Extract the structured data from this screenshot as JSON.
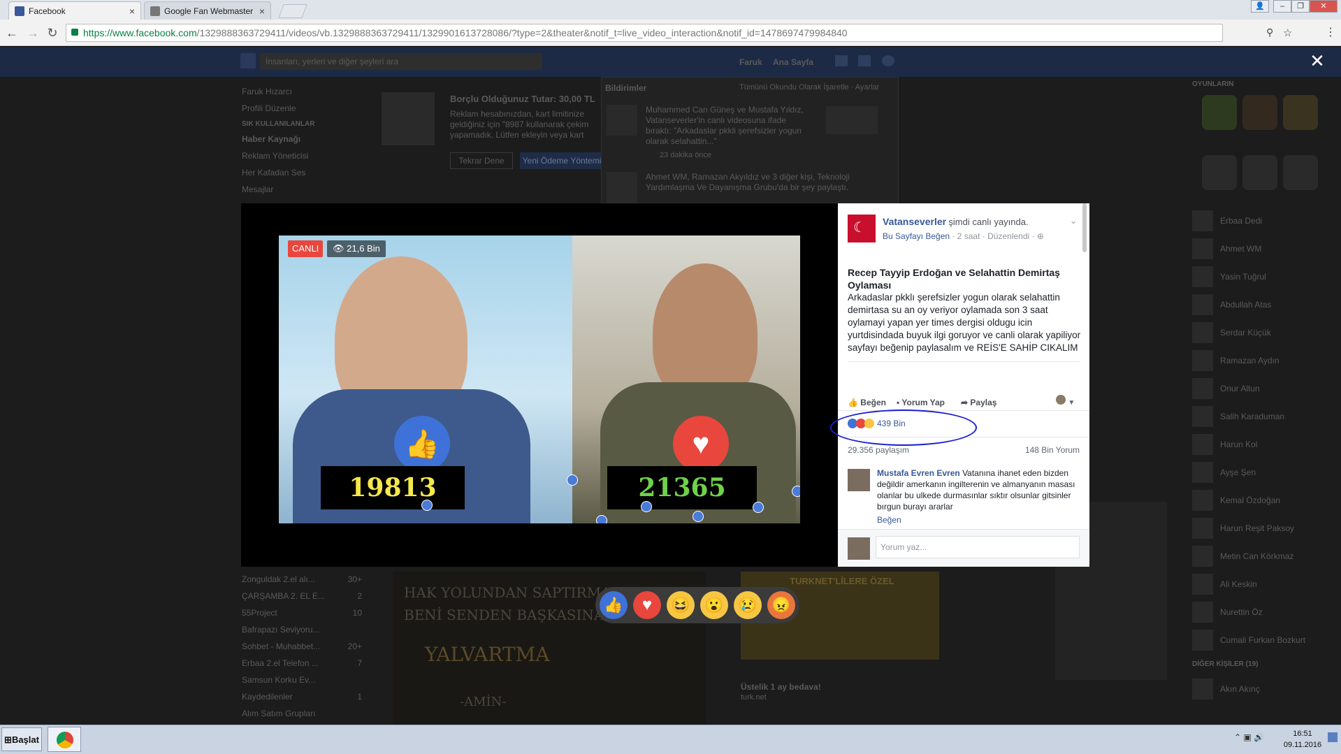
{
  "browser": {
    "tabs": [
      {
        "label": "Facebook",
        "active": true
      },
      {
        "label": "Google Fan Webmaster For",
        "active": false
      }
    ],
    "url_host": "https://www.facebook.com",
    "url_path": "/1329888363729411/videos/vb.1329888363729411/1329901613728086/?type=2&theater&notif_t=live_video_interaction&notif_id=1478697479984840"
  },
  "fb": {
    "search_placeholder": "İnsanları, yerleri ve diğer şeyleri ara",
    "user_name": "Faruk",
    "home_label": "Ana Sayfa",
    "left_nav": [
      "Faruk Hızarcı",
      "Profili Düzenle",
      "SIK KULLANILANLAR",
      "Haber Kaynağı",
      "Reklam Yöneticisi",
      "Her Kafadan Ses",
      "Mesajlar"
    ],
    "left_groups": [
      "Zonguldak 2.el alı...",
      "ÇARŞAMBA 2. EL E...",
      "55Project",
      "Bafrapazı Seviyoru...",
      "Sohbet - Muhabbet...",
      "Erbaa 2.el Telefon ...",
      "Samsun Korku Ev...",
      "Kaydedilenler",
      "Alım Satım Grupları"
    ],
    "left_group_counts": [
      "30+",
      "2",
      "10",
      "",
      "20+",
      "7",
      "",
      "1",
      ""
    ],
    "ad_title": "Borçlu Olduğunuz Tutar: 30,00 TL",
    "ad_text": "Reklam hesabınızdan, kart limitinize geldiğiniz için \"8987 kullanarak çekim yapamadık. Lütfen ekleyin veya kart bakiyenizi ödeyin ve geçin.",
    "ad_btn_retry": "Tekrar Dene",
    "ad_btn_new": "Yeni Ödeme Yöntemi",
    "notifications_title": "Bildirimler",
    "notifications_mark": "Tümünü Okundu Olarak İşaretle · Ayarlar",
    "notif1": "Muhammed Can Güneş ve Mustafa Yıldız, Vatanseverler'in canlı videosuna ifade bıraktı: \"Arkadaslar pkkli şerefsizler yogun olarak selahattin...\"",
    "notif1_time": "23 dakika önce",
    "notif2": "Ahmet WM, Ramazan Akyıldız ve 3 diğer kişi, Teknoloji Yardımlaşma Ve Dayanışma Grubu'da bir şey paylaştı.",
    "games_title": "OYUNLARIN",
    "chat_contacts": [
      "Erbaa Dedi",
      "Ahmet WM",
      "Yasin Tuğrul",
      "Abdullah Atas",
      "Serdar Küçük",
      "Ramazan Aydın",
      "Onur Altun",
      "Salih Karaduman",
      "Harun Kol",
      "Ayşe Şen",
      "Kemal Özdoğan",
      "Harun Reşit Paksoy",
      "Metin Can Körkmaz",
      "Ali Keskin",
      "Nurettin Öz",
      "Cumali Furkan Bozkurt"
    ],
    "other_people": "DİĞER KİŞİLER (19)",
    "other_person": "Akın Akınç",
    "banner_text": "TURKNET'LİLERE ÖZEL",
    "banner_sub": "Üstelik 1 ay bedava!",
    "banner_domain": "turk.net",
    "poem_lines": [
      "HAK YOLUNDAN SAPTIRMA",
      "BENİ SENDEN BAŞKASINA",
      "YALVARTMA",
      "-AMİN-"
    ]
  },
  "video": {
    "live_badge": "CANLI",
    "viewers": "21,6 Bin",
    "left_score": "19813",
    "right_score": "21365",
    "close_label": "✕"
  },
  "post": {
    "page_name": "Vatanseverler",
    "status": "şimdi canlı yayında.",
    "like_page": "Bu Sayfayı Beğen",
    "time": "2 saat",
    "edited": "Düzenlendi",
    "title": "Recep Tayyip Erdoğan ve Selahattin Demirtaş Oylaması",
    "body": "Arkadaslar pkklı şerefsizler yogun olarak selahattin demirtasa su an oy veriyor oylamada son 3 saat oylamayi yapan yer times dergisi oldugu icin yurtdisindada buyuk ilgi goruyor ve canli olarak yapiliyor sayfayı beğenip paylasalım ve REİS'E SAHİP CIKALIM",
    "like_btn": "Beğen",
    "comment_btn": "Yorum Yap",
    "share_btn": "Paylaş",
    "reactions_count": "439 Bin",
    "shares": "29.356 paylaşım",
    "comments_count": "148 Bin Yorum",
    "commenter": "Mustafa Evren Evren",
    "comment_text": "Vatanına ihanet eden bizden değildir amerkanın ingilterenin ve almanyanın masası olanlar bu ulkede durmasınlar sıktır olsunlar gitsinler bırgun burayı ararlar",
    "comment_like": "Beğen",
    "reply_placeholder": "Yorum yaz..."
  },
  "taskbar": {
    "start": "Başlat",
    "time": "16:51",
    "date": "09.11.2016"
  },
  "colors": {
    "fb_blue": "#365899",
    "live_red": "#e9473d",
    "annotation_blue": "#1a1ed0"
  }
}
